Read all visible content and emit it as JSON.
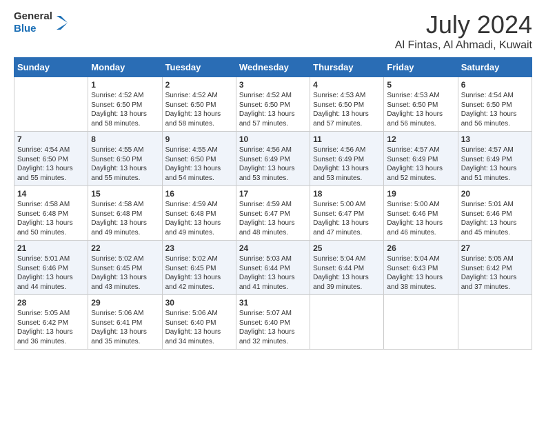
{
  "header": {
    "logo_line1": "General",
    "logo_line2": "Blue",
    "month": "July 2024",
    "location": "Al Fintas, Al Ahmadi, Kuwait"
  },
  "weekdays": [
    "Sunday",
    "Monday",
    "Tuesday",
    "Wednesday",
    "Thursday",
    "Friday",
    "Saturday"
  ],
  "weeks": [
    [
      {
        "day": "",
        "info": ""
      },
      {
        "day": "1",
        "info": "Sunrise: 4:52 AM\nSunset: 6:50 PM\nDaylight: 13 hours\nand 58 minutes."
      },
      {
        "day": "2",
        "info": "Sunrise: 4:52 AM\nSunset: 6:50 PM\nDaylight: 13 hours\nand 58 minutes."
      },
      {
        "day": "3",
        "info": "Sunrise: 4:52 AM\nSunset: 6:50 PM\nDaylight: 13 hours\nand 57 minutes."
      },
      {
        "day": "4",
        "info": "Sunrise: 4:53 AM\nSunset: 6:50 PM\nDaylight: 13 hours\nand 57 minutes."
      },
      {
        "day": "5",
        "info": "Sunrise: 4:53 AM\nSunset: 6:50 PM\nDaylight: 13 hours\nand 56 minutes."
      },
      {
        "day": "6",
        "info": "Sunrise: 4:54 AM\nSunset: 6:50 PM\nDaylight: 13 hours\nand 56 minutes."
      }
    ],
    [
      {
        "day": "7",
        "info": "Sunrise: 4:54 AM\nSunset: 6:50 PM\nDaylight: 13 hours\nand 55 minutes."
      },
      {
        "day": "8",
        "info": "Sunrise: 4:55 AM\nSunset: 6:50 PM\nDaylight: 13 hours\nand 55 minutes."
      },
      {
        "day": "9",
        "info": "Sunrise: 4:55 AM\nSunset: 6:50 PM\nDaylight: 13 hours\nand 54 minutes."
      },
      {
        "day": "10",
        "info": "Sunrise: 4:56 AM\nSunset: 6:49 PM\nDaylight: 13 hours\nand 53 minutes."
      },
      {
        "day": "11",
        "info": "Sunrise: 4:56 AM\nSunset: 6:49 PM\nDaylight: 13 hours\nand 53 minutes."
      },
      {
        "day": "12",
        "info": "Sunrise: 4:57 AM\nSunset: 6:49 PM\nDaylight: 13 hours\nand 52 minutes."
      },
      {
        "day": "13",
        "info": "Sunrise: 4:57 AM\nSunset: 6:49 PM\nDaylight: 13 hours\nand 51 minutes."
      }
    ],
    [
      {
        "day": "14",
        "info": "Sunrise: 4:58 AM\nSunset: 6:48 PM\nDaylight: 13 hours\nand 50 minutes."
      },
      {
        "day": "15",
        "info": "Sunrise: 4:58 AM\nSunset: 6:48 PM\nDaylight: 13 hours\nand 49 minutes."
      },
      {
        "day": "16",
        "info": "Sunrise: 4:59 AM\nSunset: 6:48 PM\nDaylight: 13 hours\nand 49 minutes."
      },
      {
        "day": "17",
        "info": "Sunrise: 4:59 AM\nSunset: 6:47 PM\nDaylight: 13 hours\nand 48 minutes."
      },
      {
        "day": "18",
        "info": "Sunrise: 5:00 AM\nSunset: 6:47 PM\nDaylight: 13 hours\nand 47 minutes."
      },
      {
        "day": "19",
        "info": "Sunrise: 5:00 AM\nSunset: 6:46 PM\nDaylight: 13 hours\nand 46 minutes."
      },
      {
        "day": "20",
        "info": "Sunrise: 5:01 AM\nSunset: 6:46 PM\nDaylight: 13 hours\nand 45 minutes."
      }
    ],
    [
      {
        "day": "21",
        "info": "Sunrise: 5:01 AM\nSunset: 6:46 PM\nDaylight: 13 hours\nand 44 minutes."
      },
      {
        "day": "22",
        "info": "Sunrise: 5:02 AM\nSunset: 6:45 PM\nDaylight: 13 hours\nand 43 minutes."
      },
      {
        "day": "23",
        "info": "Sunrise: 5:02 AM\nSunset: 6:45 PM\nDaylight: 13 hours\nand 42 minutes."
      },
      {
        "day": "24",
        "info": "Sunrise: 5:03 AM\nSunset: 6:44 PM\nDaylight: 13 hours\nand 41 minutes."
      },
      {
        "day": "25",
        "info": "Sunrise: 5:04 AM\nSunset: 6:44 PM\nDaylight: 13 hours\nand 39 minutes."
      },
      {
        "day": "26",
        "info": "Sunrise: 5:04 AM\nSunset: 6:43 PM\nDaylight: 13 hours\nand 38 minutes."
      },
      {
        "day": "27",
        "info": "Sunrise: 5:05 AM\nSunset: 6:42 PM\nDaylight: 13 hours\nand 37 minutes."
      }
    ],
    [
      {
        "day": "28",
        "info": "Sunrise: 5:05 AM\nSunset: 6:42 PM\nDaylight: 13 hours\nand 36 minutes."
      },
      {
        "day": "29",
        "info": "Sunrise: 5:06 AM\nSunset: 6:41 PM\nDaylight: 13 hours\nand 35 minutes."
      },
      {
        "day": "30",
        "info": "Sunrise: 5:06 AM\nSunset: 6:40 PM\nDaylight: 13 hours\nand 34 minutes."
      },
      {
        "day": "31",
        "info": "Sunrise: 5:07 AM\nSunset: 6:40 PM\nDaylight: 13 hours\nand 32 minutes."
      },
      {
        "day": "",
        "info": ""
      },
      {
        "day": "",
        "info": ""
      },
      {
        "day": "",
        "info": ""
      }
    ]
  ]
}
